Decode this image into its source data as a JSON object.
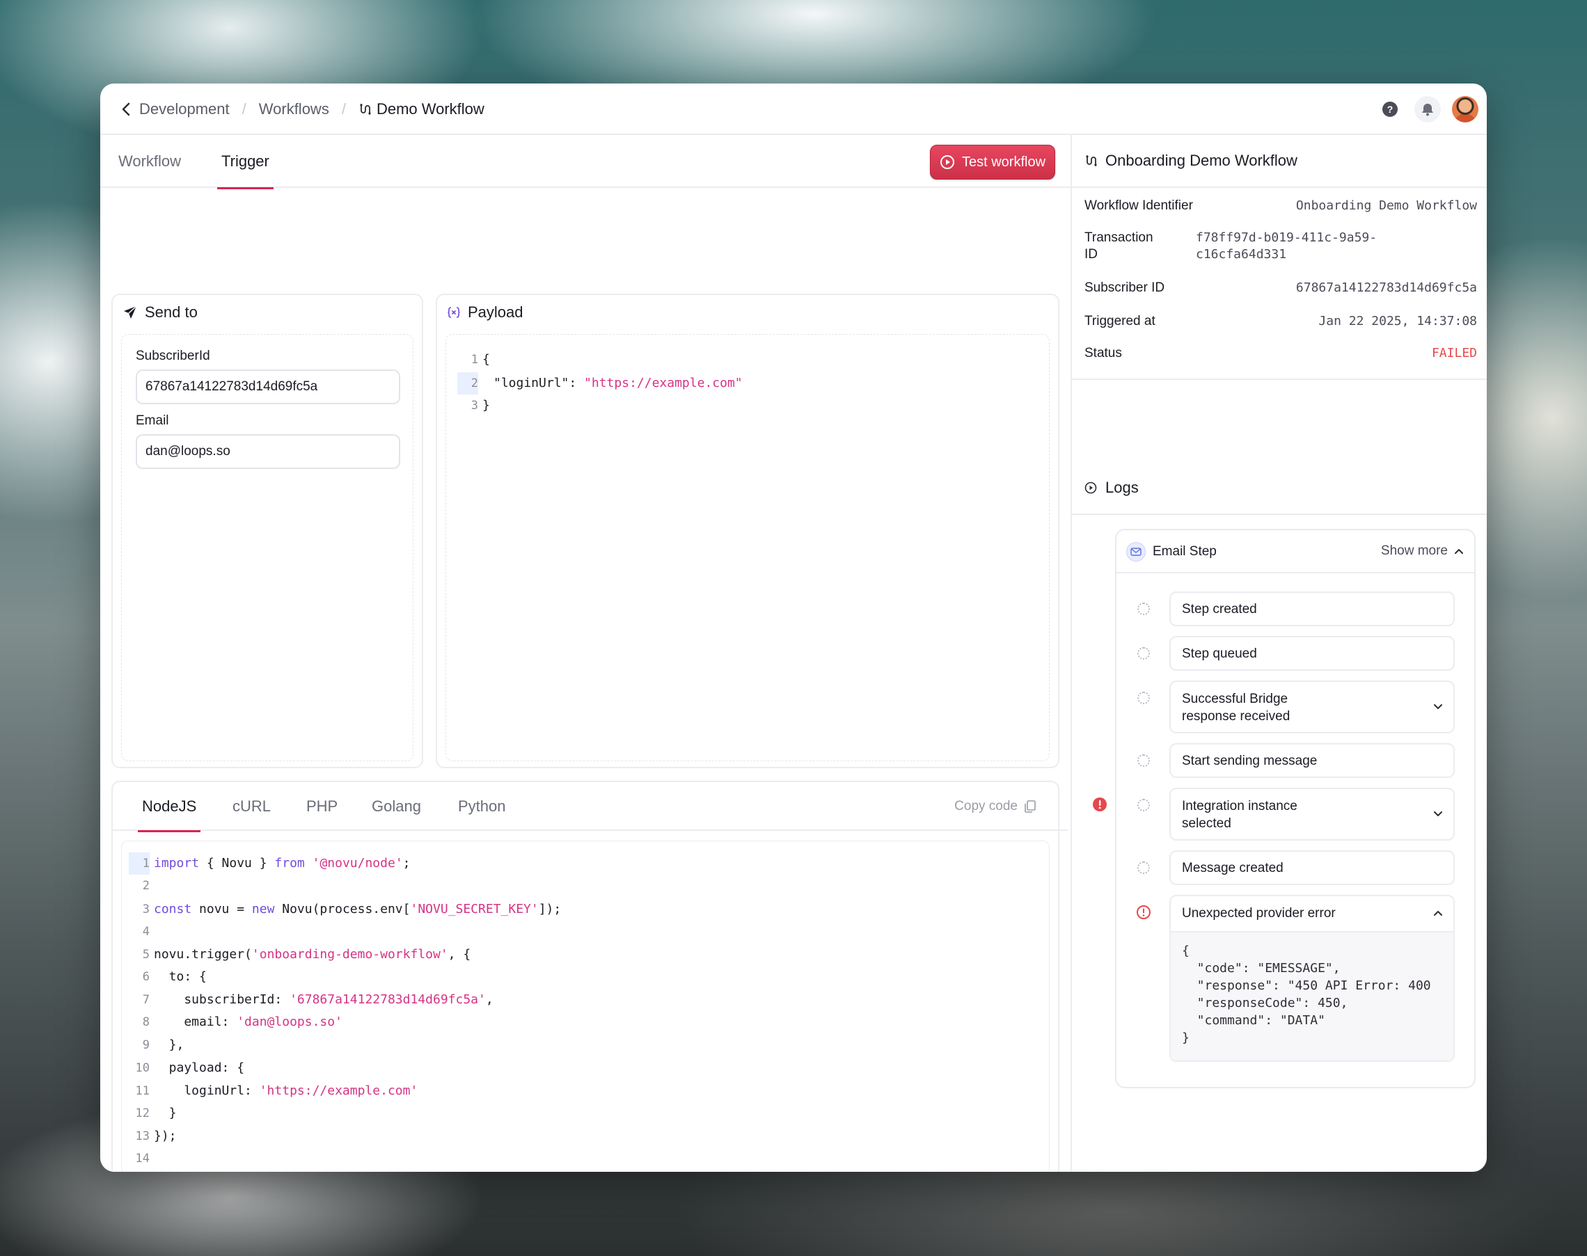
{
  "breadcrumb": {
    "items": [
      "Development",
      "Workflows"
    ],
    "current": "Demo Workflow"
  },
  "tabs": [
    "Workflow",
    "Trigger"
  ],
  "active_tab": "Trigger",
  "test_button": "Test workflow",
  "send_to": {
    "title": "Send to",
    "subscriber_label": "SubscriberId",
    "subscriber_value": "67867a14122783d14d69fc5a",
    "email_label": "Email",
    "email_value": "dan@loops.so"
  },
  "payload": {
    "title": "Payload",
    "lines": [
      {
        "n": "1",
        "text": "{"
      },
      {
        "n": "2",
        "key": "\"loginUrl\": ",
        "value": "\"https://example.com\""
      },
      {
        "n": "3",
        "text": "}"
      }
    ]
  },
  "code_tabs": [
    "NodeJS",
    "cURL",
    "PHP",
    "Golang",
    "Python"
  ],
  "active_code_tab": "NodeJS",
  "copy_label": "Copy code",
  "code": {
    "line_numbers": [
      "1",
      "2",
      "3",
      "4",
      "5",
      "6",
      "7",
      "8",
      "9",
      "10",
      "11",
      "12",
      "13",
      "14"
    ],
    "l1_kw1": "import",
    "l1_mid": " { Novu } ",
    "l1_kw2": "from",
    "l1_str": "'@novu/node'",
    "l1_end": ";",
    "l3_kw1": "const",
    "l3_mid": " novu = ",
    "l3_kw2": "new",
    "l3_mid2": " Novu(process.env[",
    "l3_str": "'NOVU_SECRET_KEY'",
    "l3_end": "]);",
    "l5_pre": "novu.trigger(",
    "l5_str": "'onboarding-demo-workflow'",
    "l5_end": ", {",
    "l6": "  to: {",
    "l7_pre": "    subscriberId: ",
    "l7_str": "'67867a14122783d14d69fc5a'",
    "l7_end": ",",
    "l8_pre": "    email: ",
    "l8_str": "'dan@loops.so'",
    "l9": "  },",
    "l10": "  payload: {",
    "l11_pre": "    loginUrl: ",
    "l11_str": "'https://example.com'",
    "l12": "  }",
    "l13": "});"
  },
  "panel": {
    "title": "Onboarding Demo Workflow",
    "workflow_identifier_label": "Workflow Identifier",
    "workflow_identifier": "Onboarding Demo Workflow",
    "transaction_label_1": "Transaction",
    "transaction_label_2": "ID",
    "transaction_id_1": "f78ff97d-b019-411c-9a59-",
    "transaction_id_2": "c16cfa64d331",
    "subscriber_label": "Subscriber ID",
    "subscriber_id": "67867a14122783d14d69fc5a",
    "triggered_label": "Triggered at",
    "triggered_at": "Jan 22 2025, 14:37:08",
    "status_label": "Status",
    "status": "FAILED",
    "logs_title": "Logs"
  },
  "email_step": {
    "title": "Email Step",
    "show_more": "Show more",
    "steps": [
      {
        "label_1": "Step created"
      },
      {
        "label_1": "Step queued"
      },
      {
        "label_1": "Successful Bridge",
        "label_2": "response received"
      },
      {
        "label_1": "Start sending message"
      },
      {
        "label_1": "Integration instance",
        "label_2": "selected"
      },
      {
        "label_1": "Message created"
      },
      {
        "label_1": "Unexpected provider error"
      }
    ],
    "error_json": "{\n  \"code\": \"EMESSAGE\",\n  \"response\": \"450 API Error: 400\n  \"responseCode\": 450,\n  \"command\": \"DATA\"\n}"
  },
  "colors": {
    "accent": "#dd2450",
    "failed": "#e5484d",
    "string": "#d63384",
    "keyword": "#6f4bdb"
  }
}
